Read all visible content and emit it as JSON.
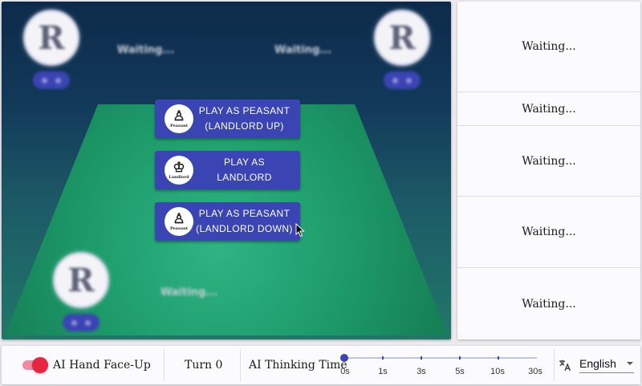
{
  "board": {
    "players": [
      {
        "id": "top-left",
        "status": "Waiting..."
      },
      {
        "id": "top-right",
        "status": "Waiting..."
      },
      {
        "id": "bottom",
        "status": "Waiting..."
      }
    ],
    "play_buttons": [
      {
        "line1": "PLAY AS PEASANT",
        "line2": "(LANDLORD UP)",
        "badge_text": "Peasant"
      },
      {
        "line1": "PLAY AS",
        "line2": "LANDLORD",
        "badge_text": "Landlord"
      },
      {
        "line1": "PLAY AS PEASANT",
        "line2": "(LANDLORD DOWN)",
        "badge_text": "Peasant"
      }
    ]
  },
  "side_panel": {
    "rows": [
      "Waiting...",
      "Waiting...",
      "Waiting...",
      "Waiting...",
      "Waiting..."
    ]
  },
  "bottom_bar": {
    "ai_hand_label": "AI Hand Face-Up",
    "ai_hand_on": true,
    "turn_label": "Turn 0",
    "thinking_label": "AI Thinking Time",
    "thinking_value": "0s",
    "thinking_marks": [
      "0s",
      "1s",
      "3s",
      "5s",
      "10s",
      "30s"
    ],
    "language": "English"
  },
  "colors": {
    "accent": "#3a44b2",
    "switch": "#e8253f",
    "felt": "#1d9a6a"
  }
}
